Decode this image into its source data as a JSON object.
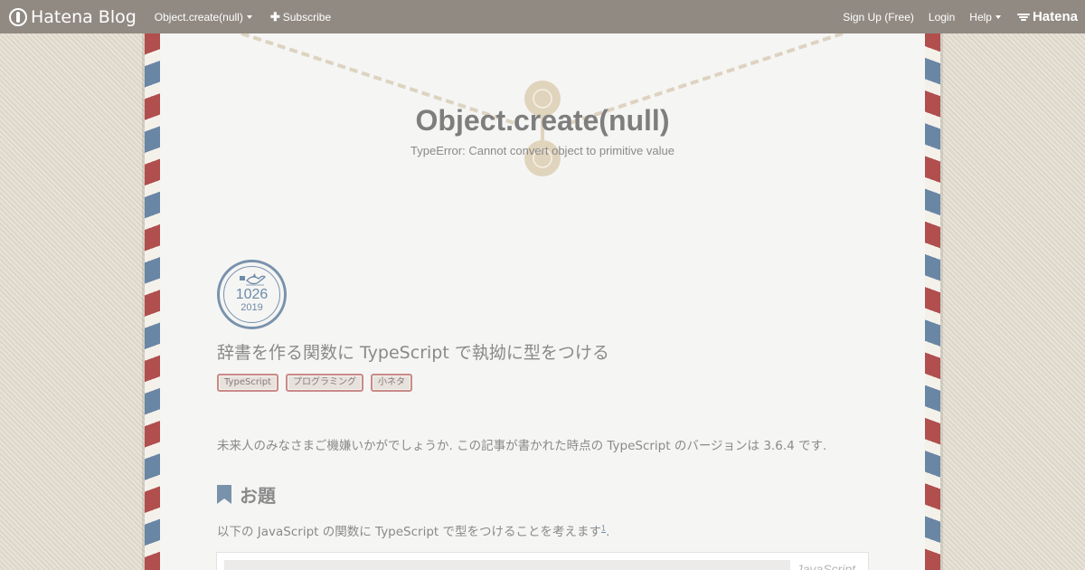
{
  "topbar": {
    "brand": "Hatena Blog",
    "blog_menu": "Object.create(null)",
    "subscribe": "Subscribe",
    "signup": "Sign Up (Free)",
    "login": "Login",
    "help": "Help",
    "hatena": "Hatena"
  },
  "blog": {
    "title": "Object.create(null)",
    "description": "TypeError: Cannot convert object to primitive value"
  },
  "entry": {
    "date_md": "1026",
    "date_year": "2019",
    "title": "辞書を作る関数に TypeScript で執拗に型をつける",
    "tags": [
      "TypeScript",
      "プログラミング",
      "小ネタ"
    ],
    "intro": "未来人のみなさまご機嫌いかがでしょうか. この記事が書かれた時点の TypeScript のバージョンは 3.6.4 です.",
    "section_heading": "お題",
    "paragraph": "以下の JavaScript の関数に TypeScript で型をつけることを考えます",
    "footnote": "1",
    "paragraph_end": ".",
    "code_lang": "JavaScript"
  },
  "colors": {
    "topbar": "#918a82",
    "airmail_red": "#b04f4e",
    "airmail_blue": "#6a86a5",
    "stamp_blue": "#7992ab",
    "text": "#8a8a8a"
  }
}
